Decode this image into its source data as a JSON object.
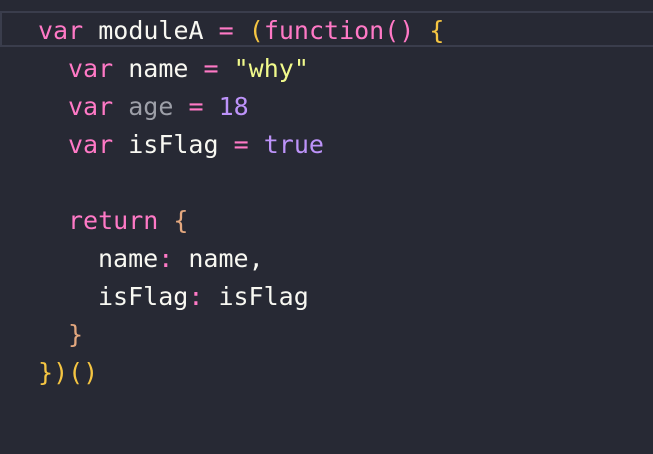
{
  "colors": {
    "background": "#272934",
    "keyword": "#ff79c6",
    "string": "#f1fa8c",
    "number": "#bd93f9",
    "identifier": "#f8f8f2",
    "bracket_outer": "#f5c542",
    "bracket_nested": "#e4a87f"
  },
  "code": {
    "line1": {
      "kw": "var",
      "name": "moduleA",
      "eq": "=",
      "paren_open": "(",
      "fn_kw": "function",
      "fn_parens": "()",
      "brace_open": "{"
    },
    "line2": {
      "kw": "var",
      "name": "name",
      "eq": "=",
      "value": "\"why\""
    },
    "line3": {
      "kw": "var",
      "name": "age",
      "eq": "=",
      "value": "18"
    },
    "line4": {
      "kw": "var",
      "name": "isFlag",
      "eq": "=",
      "value": "true"
    },
    "line6": {
      "kw": "return",
      "brace_open": "{"
    },
    "line7": {
      "key": "name",
      "colon": ":",
      "value": "name",
      "comma": ","
    },
    "line8": {
      "key": "isFlag",
      "colon": ":",
      "value": "isFlag"
    },
    "line9": {
      "brace_close": "}"
    },
    "line10": {
      "brace_close": "}",
      "paren_close": ")",
      "invoke": "()"
    }
  }
}
